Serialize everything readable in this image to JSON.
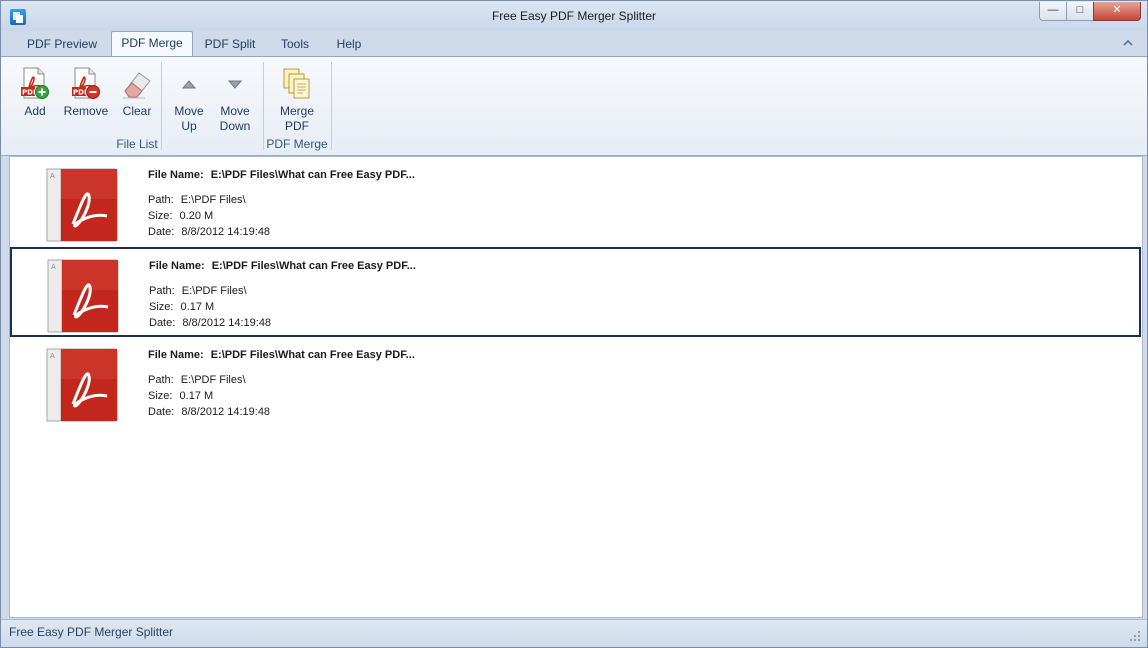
{
  "window": {
    "title": "Free Easy PDF Merger Splitter",
    "controls": {
      "minimize": "—",
      "maximize": "□",
      "close": "✕"
    }
  },
  "tabs": [
    {
      "label": "PDF Preview",
      "active": false
    },
    {
      "label": "PDF Merge",
      "active": true
    },
    {
      "label": "PDF Split",
      "active": false
    },
    {
      "label": "Tools",
      "active": false
    },
    {
      "label": "Help",
      "active": false
    }
  ],
  "ribbon": {
    "file_list_group": {
      "label": "File List",
      "buttons": {
        "add": "Add",
        "remove": "Remove",
        "clear": "Clear",
        "move_up_1": "Move",
        "move_up_2": "Up",
        "move_down_1": "Move",
        "move_down_2": "Down"
      }
    },
    "merge_group": {
      "label": "PDF Merge",
      "buttons": {
        "merge_1": "Merge",
        "merge_2": "PDF"
      }
    }
  },
  "files": [
    {
      "name_label": "File Name:",
      "name": "E:\\PDF Files\\What can Free Easy PDF...",
      "path_label": "Path:",
      "path": "E:\\PDF Files\\",
      "size_label": "Size:",
      "size": "0.20 M",
      "date_label": "Date:",
      "date": "8/8/2012 14:19:48",
      "selected": false
    },
    {
      "name_label": "File Name:",
      "name": "E:\\PDF Files\\What can Free Easy PDF...",
      "path_label": "Path:",
      "path": "E:\\PDF Files\\",
      "size_label": "Size:",
      "size": "0.17 M",
      "date_label": "Date:",
      "date": "8/8/2012 14:19:48",
      "selected": true
    },
    {
      "name_label": "File Name:",
      "name": "E:\\PDF Files\\What can Free Easy PDF...",
      "path_label": "Path:",
      "path": "E:\\PDF Files\\",
      "size_label": "Size:",
      "size": "0.17 M",
      "date_label": "Date:",
      "date": "8/8/2012 14:19:48",
      "selected": false
    }
  ],
  "statusbar": {
    "text": "Free Easy PDF Merger Splitter"
  },
  "icons": {
    "app": "app-icon",
    "add": "pdf-add-icon",
    "remove": "pdf-remove-icon",
    "clear": "eraser-icon",
    "move_up": "triangle-up-icon",
    "move_down": "triangle-down-icon",
    "merge": "merge-documents-icon",
    "file": "pdf-file-icon"
  },
  "colors": {
    "accent": "#1c2f52",
    "pdf_red": "#c8281e",
    "ribbon_text": "#1e3a5f"
  }
}
